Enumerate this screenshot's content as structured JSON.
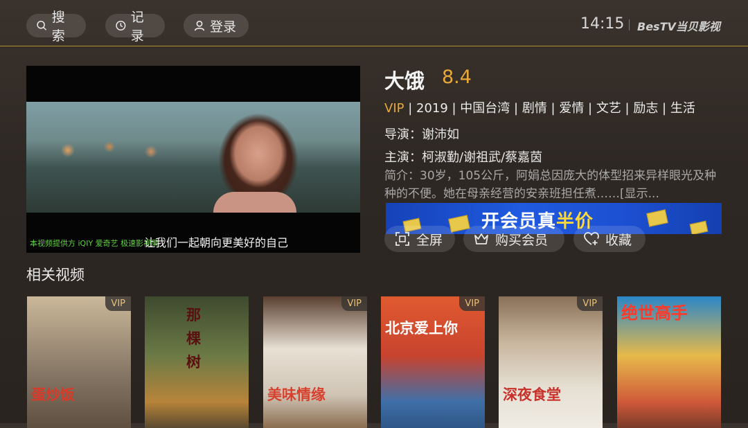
{
  "header": {
    "search_label": "搜索",
    "history_label": "记录",
    "login_label": "登录",
    "time": "14:15",
    "brand": "BesTV当贝影视"
  },
  "player": {
    "subtitle": "让我们一起朝向更美好的自己",
    "provider_text": "本视频提供方 iQIY 爱奇艺 极速影视果"
  },
  "movie": {
    "title": "大饿",
    "score": "8.4",
    "vip": "VIP",
    "meta": " | 2019 | 中国台湾 | 剧情 | 爱情 | 文艺 | 励志 | 生活",
    "director": "导演：谢沛如",
    "cast": "主演：柯淑勤/谢祖武/蔡嘉茵",
    "description": "简介：30岁，105公斤，阿娟总因庞大的体型招来异样眼光及种种的不便。她在母亲经营的安亲班担任煮……[显示..."
  },
  "banner": {
    "text_main": "开会员真",
    "text_highlight": "半价"
  },
  "actions": {
    "fullscreen": "全屏",
    "buy_vip": "购买会员",
    "favorite": "收藏"
  },
  "related": {
    "title": "相关视频",
    "items": [
      {
        "title": "蛋炒饭",
        "vip": "VIP",
        "bg": "#8a7a68"
      },
      {
        "title": "那棵树",
        "vip": "",
        "bg": "#4e5a3a"
      },
      {
        "title": "美味情缘",
        "vip": "VIP",
        "bg": "#b9a48a"
      },
      {
        "title": "北京爱上你",
        "vip": "VIP",
        "bg": "#c8432e"
      },
      {
        "title": "深夜食堂",
        "vip": "VIP",
        "bg": "#d9d2c2"
      },
      {
        "title": "绝世高手",
        "vip": "",
        "bg": "#2a86c8"
      }
    ]
  },
  "colors": {
    "accent": "#e8a83a",
    "divider": "#b3902e"
  }
}
